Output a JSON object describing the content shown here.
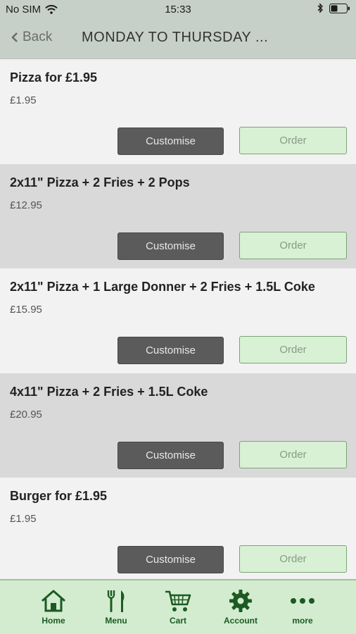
{
  "status": {
    "carrier": "No SIM",
    "time": "15:33"
  },
  "nav": {
    "back_label": "Back",
    "title": "MONDAY TO THURSDAY ..."
  },
  "items": [
    {
      "title": "Pizza for £1.95",
      "price": "£1.95",
      "customise": "Customise",
      "order": "Order"
    },
    {
      "title": "2x11\" Pizza + 2 Fries + 2 Pops",
      "price": "£12.95",
      "customise": "Customise",
      "order": "Order"
    },
    {
      "title": "2x11\" Pizza + 1 Large Donner + 2 Fries + 1.5L Coke",
      "price": "£15.95",
      "customise": "Customise",
      "order": "Order"
    },
    {
      "title": "4x11\" Pizza + 2 Fries + 1.5L Coke",
      "price": "£20.95",
      "customise": "Customise",
      "order": "Order"
    },
    {
      "title": "Burger for £1.95",
      "price": "£1.95",
      "customise": "Customise",
      "order": "Order"
    }
  ],
  "tabs": [
    {
      "label": "Home",
      "icon": "home-icon"
    },
    {
      "label": "Menu",
      "icon": "fork-knife-icon"
    },
    {
      "label": "Cart",
      "icon": "cart-icon"
    },
    {
      "label": "Account",
      "icon": "gear-icon"
    },
    {
      "label": "more",
      "icon": "more-icon"
    }
  ],
  "colors": {
    "header_bg": "#c7d0c8",
    "tab_bg": "#d3eccf",
    "accent": "#1c5a23",
    "customise_bg": "#5b5b5b",
    "order_bg": "#d8f0d4"
  }
}
